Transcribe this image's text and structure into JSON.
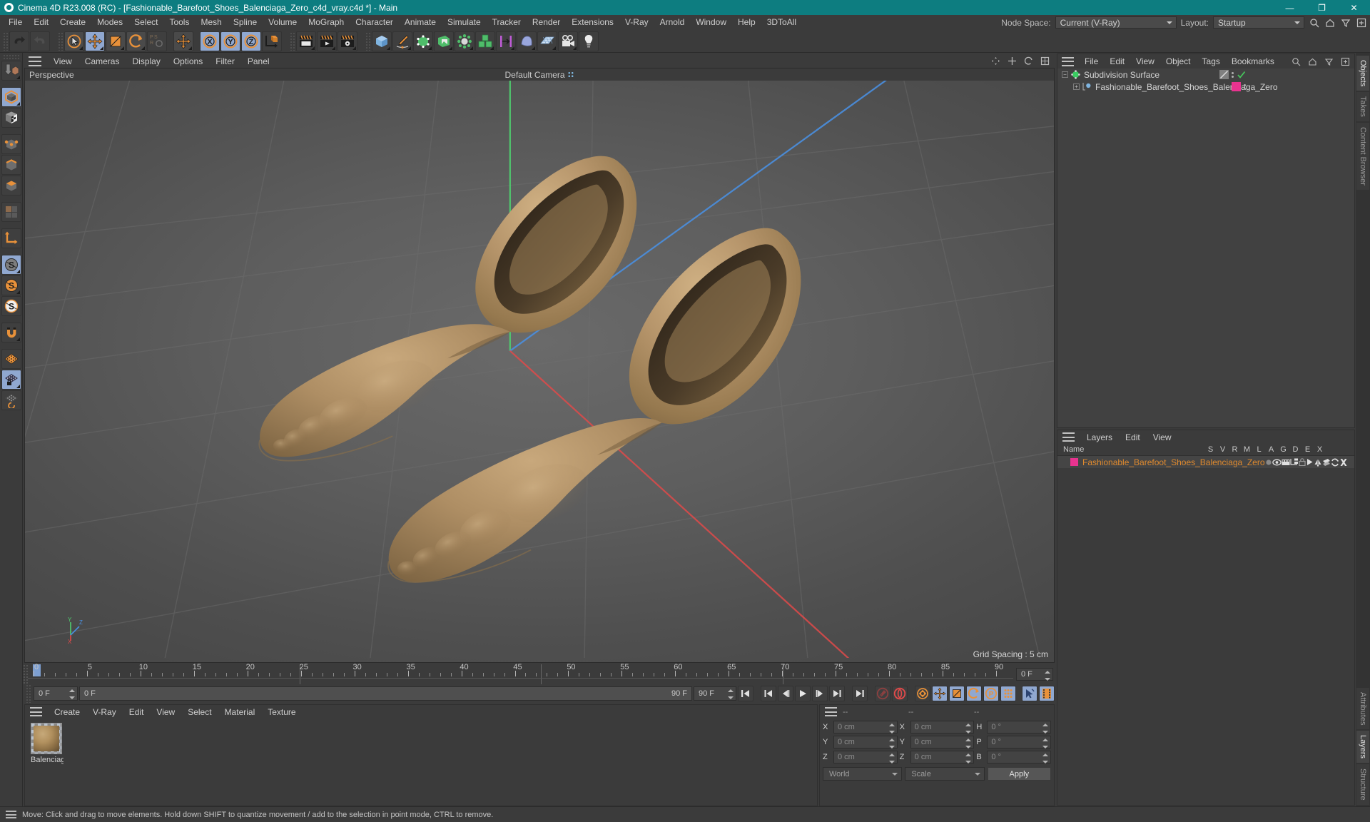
{
  "titlebar": {
    "title": "Cinema 4D R23.008 (RC) - [Fashionable_Barefoot_Shoes_Balenciaga_Zero_c4d_vray.c4d *] - Main",
    "minimize": "—",
    "maximize": "❐",
    "close": "✕"
  },
  "menubar": {
    "items": [
      "File",
      "Edit",
      "Create",
      "Modes",
      "Select",
      "Tools",
      "Mesh",
      "Spline",
      "Volume",
      "MoGraph",
      "Character",
      "Animate",
      "Simulate",
      "Tracker",
      "Render",
      "Extensions",
      "V-Ray",
      "Arnold",
      "Window",
      "Help",
      "3DToAll"
    ],
    "node_space_label": "Node Space:",
    "node_space_value": "Current (V-Ray)",
    "layout_label": "Layout:",
    "layout_value": "Startup"
  },
  "viewport": {
    "menu": [
      "View",
      "Cameras",
      "Display",
      "Options",
      "Filter",
      "Panel"
    ],
    "view_name": "Perspective",
    "camera": "Default Camera",
    "grid_spacing": "Grid Spacing : 5 cm",
    "axis_x": "X",
    "axis_y": "Y",
    "axis_z": "Z"
  },
  "timeline": {
    "ticks": [
      0,
      5,
      10,
      15,
      20,
      25,
      30,
      35,
      40,
      45,
      50,
      55,
      60,
      65,
      70,
      75,
      80,
      85,
      90
    ],
    "current_frame": "0 F",
    "start_frame": "0 F",
    "preview_start": "0 F",
    "end_frame": "90 F",
    "preview_end": "90 F",
    "range_end": "90 F"
  },
  "material_manager": {
    "menu": [
      "Create",
      "V-Ray",
      "Edit",
      "View",
      "Select",
      "Material",
      "Texture"
    ],
    "materials": [
      {
        "name": "Balenciaga"
      }
    ]
  },
  "coordinates": {
    "header": [
      "--",
      "--",
      "--"
    ],
    "rows": [
      {
        "label1": "X",
        "value1": "0 cm",
        "label2": "X",
        "value2": "0 cm",
        "label3": "H",
        "value3": "0 °"
      },
      {
        "label1": "Y",
        "value1": "0 cm",
        "label2": "Y",
        "value2": "0 cm",
        "label3": "P",
        "value3": "0 °"
      },
      {
        "label1": "Z",
        "value1": "0 cm",
        "label2": "Z",
        "value2": "0 cm",
        "label3": "B",
        "value3": "0 °"
      }
    ],
    "system": "World",
    "mode": "Scale",
    "apply": "Apply"
  },
  "objects_panel": {
    "menu": [
      "File",
      "Edit",
      "View",
      "Object",
      "Tags",
      "Bookmarks"
    ],
    "rows": [
      {
        "name": "Subdivision Surface",
        "expander": "−",
        "indent": 0
      },
      {
        "name": "Fashionable_Barefoot_Shoes_Balenciaga_Zero",
        "expander": "+",
        "indent": 1
      }
    ]
  },
  "layers_panel": {
    "menu": [
      "Layers",
      "Edit",
      "View"
    ],
    "columns": [
      "Name",
      "S",
      "V",
      "R",
      "M",
      "L",
      "A",
      "G",
      "D",
      "E",
      "X"
    ],
    "rows": [
      {
        "name": "Fashionable_Barefoot_Shoes_Balenciaga_Zero",
        "color": "#e8338f"
      }
    ]
  },
  "vertical_tabs_top": [
    "Objects",
    "Takes",
    "Content Browser"
  ],
  "vertical_tabs_bottom": [
    "Attributes",
    "Layers",
    "Structure"
  ],
  "statusbar": {
    "message": "Move: Click and drag to move elements. Hold down SHIFT to quantize movement / add to the selection in point mode, CTRL to remove."
  },
  "colors": {
    "title_bar": "#0d7d80",
    "accent_orange": "#e8913a",
    "accent_blue": "#90a8d0",
    "layer_pink": "#e8338f",
    "model_tan": "#b08f5e"
  }
}
